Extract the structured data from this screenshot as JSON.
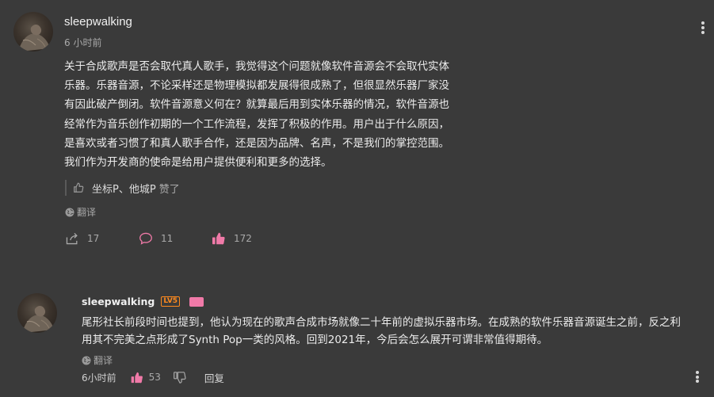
{
  "post": {
    "username": "sleepwalking",
    "time": "6 小时前",
    "paragraph_lines": [
      "关于合成歌声是否会取代真人歌手，我觉得这个问题就像软件音源会不会取代实体",
      "乐器。乐器音源，不论采样还是物理模拟都发展得很成熟了，但很显然乐器厂家没",
      "有因此破产倒闭。软件音源意义何在？就算最后用到实体乐器的情况，软件音源也",
      "经常作为音乐创作初期的一个工作流程，发挥了积极的作用。用户出于什么原因，",
      "是喜欢或者习惯了和真人歌手合作，还是因为品牌、名声，不是我们的掌控范围。",
      "我们作为开发商的使命是给用户提供便利和更多的选择。"
    ],
    "liked_by": "坐标P、他城P",
    "liked_suffix": "赞了",
    "translate_label": "翻译",
    "share_count": "17",
    "comment_count": "11",
    "like_count": "172"
  },
  "reply": {
    "username": "sleepwalking",
    "level_badge": "LV5",
    "text_lines": [
      "尾形社长前段时间也提到，他认为现在的歌声合成市场就像二十年前的虚拟乐器市场。在成熟的软件乐器音源诞生之前，反之利",
      "用其不完美之点形成了Synth Pop一类的风格。回到2021年，今后会怎么展开可谓非常值得期待。"
    ],
    "translate_label": "翻译",
    "time": "6小时前",
    "like_count": "53",
    "reply_label": "回复"
  },
  "colors": {
    "background": "#3a3a3a",
    "like_active": "#f07aa8",
    "level_badge": "#ff8a1e"
  },
  "icons": [
    "more-vertical-icon",
    "thumb-up-outline-icon",
    "globe-icon",
    "share-icon",
    "comment-icon",
    "thumb-up-filled-icon",
    "thumb-down-icon"
  ]
}
